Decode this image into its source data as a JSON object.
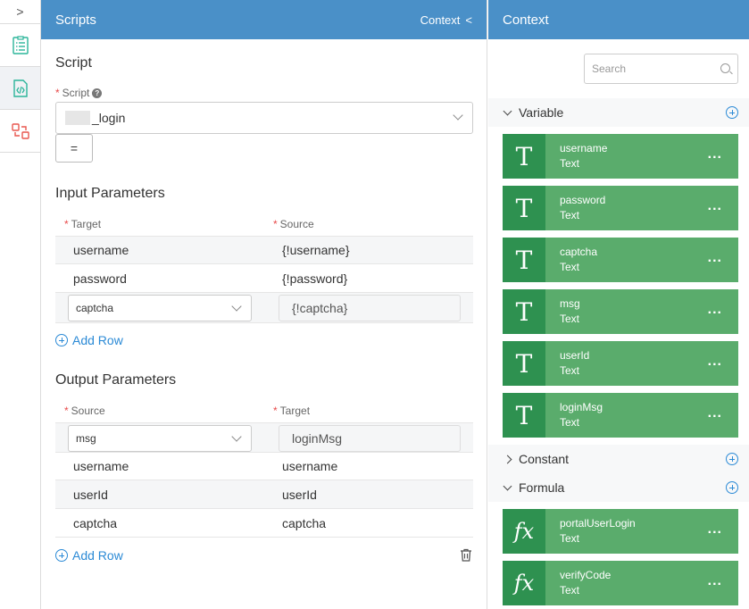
{
  "rail": {
    "toggle": ">"
  },
  "scripts_panel": {
    "title": "Scripts",
    "context_link": "Context",
    "context_arrow": "<",
    "script_section_title": "Script",
    "script_label": "Script",
    "script_value": "_login",
    "eq_label": "=",
    "input_title": "Input Parameters",
    "input_headers": {
      "target": "Target",
      "source": "Source"
    },
    "input_rows": [
      {
        "target": "username",
        "source": "{!username}"
      },
      {
        "target": "password",
        "source": "{!password}"
      },
      {
        "target": "captcha",
        "source": "{!captcha}"
      }
    ],
    "add_row": "Add Row",
    "output_title": "Output Parameters",
    "output_headers": {
      "source": "Source",
      "target": "Target"
    },
    "output_rows": [
      {
        "source": "msg",
        "target": "loginMsg"
      },
      {
        "source": "username",
        "target": "username"
      },
      {
        "source": "userId",
        "target": "userId"
      },
      {
        "source": "captcha",
        "target": "captcha"
      }
    ]
  },
  "context_panel": {
    "title": "Context",
    "search_placeholder": "Search",
    "groups": {
      "variable": "Variable",
      "constant": "Constant",
      "formula": "Formula"
    },
    "variables": [
      {
        "name": "username",
        "type": "Text"
      },
      {
        "name": "password",
        "type": "Text"
      },
      {
        "name": "captcha",
        "type": "Text"
      },
      {
        "name": "msg",
        "type": "Text"
      },
      {
        "name": "userId",
        "type": "Text"
      },
      {
        "name": "loginMsg",
        "type": "Text"
      }
    ],
    "formulas": [
      {
        "name": "portalUserLogin",
        "type": "Text"
      },
      {
        "name": "verifyCode",
        "type": "Text"
      }
    ],
    "variable_icon": "T",
    "formula_icon": "fx",
    "more_label": "..."
  },
  "colors": {
    "header": "#4a90c8",
    "card": "#5aac6c",
    "card_tile": "#2e9150",
    "link": "#2b8ad6",
    "required": "#e84a4a"
  }
}
